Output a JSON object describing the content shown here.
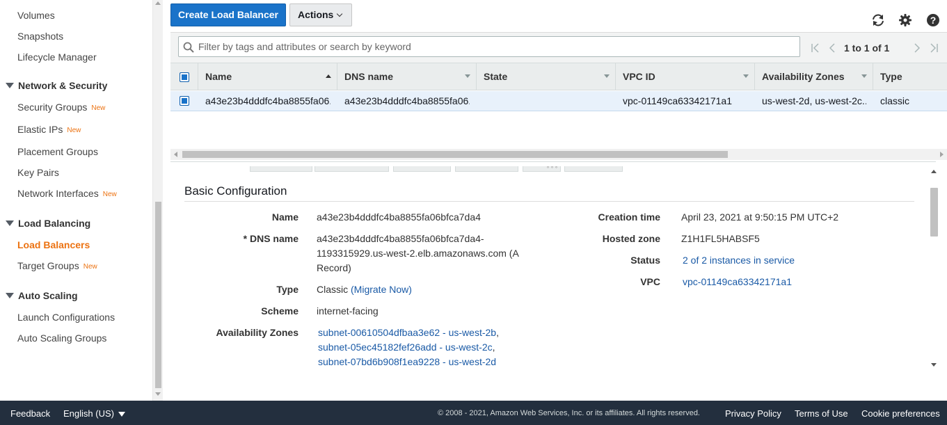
{
  "sidebar": {
    "links_top": [
      {
        "label": "Volumes"
      },
      {
        "label": "Snapshots"
      },
      {
        "label": "Lifecycle Manager"
      }
    ],
    "network_security": {
      "title": "Network & Security",
      "items": [
        {
          "label": "Security Groups",
          "badge": "New"
        },
        {
          "label": "Elastic IPs",
          "badge": "New"
        },
        {
          "label": "Placement Groups"
        },
        {
          "label": "Key Pairs"
        },
        {
          "label": "Network Interfaces",
          "badge": "New"
        }
      ]
    },
    "load_balancing": {
      "title": "Load Balancing",
      "items": [
        {
          "label": "Load Balancers"
        },
        {
          "label": "Target Groups",
          "badge": "New"
        }
      ]
    },
    "auto_scaling": {
      "title": "Auto Scaling",
      "items": [
        {
          "label": "Launch Configurations"
        },
        {
          "label": "Auto Scaling Groups"
        }
      ]
    }
  },
  "toolbar": {
    "create_label": "Create Load Balancer",
    "actions_label": "Actions",
    "icons": [
      "refresh-icon",
      "gear-icon",
      "help-icon"
    ]
  },
  "filter": {
    "placeholder": "Filter by tags and attributes or search by keyword",
    "pager_text": "1 to 1 of 1"
  },
  "table": {
    "columns": [
      "Name",
      "DNS name",
      "State",
      "VPC ID",
      "Availability Zones",
      "Type"
    ],
    "rows": [
      {
        "name": "a43e23b4dddfc4ba8855fa06...",
        "dns": "a43e23b4dddfc4ba8855fa06...",
        "state": "",
        "vpc": "vpc-01149ca63342171a1",
        "zones": "us-west-2d, us-west-2c...",
        "type": "classic"
      }
    ]
  },
  "detail": {
    "title": "Basic Configuration",
    "left": {
      "name_label": "Name",
      "name_value": "a43e23b4dddfc4ba8855fa06bfca7da4",
      "dns_label": "* DNS name",
      "dns_value_lines": [
        "a43e23b4dddfc4ba8855fa06bfca7da4-",
        "1193315929.us-west-2.elb.amazonaws.com (A",
        "Record)"
      ],
      "type_label": "Type",
      "type_value": "Classic",
      "type_link": "(Migrate Now)",
      "scheme_label": "Scheme",
      "scheme_value": "internet-facing",
      "az_label": "Availability Zones",
      "az_values": [
        "subnet-00610504dfbaa3e62 - us-west-2b",
        "subnet-05ec45182fef26add - us-west-2c",
        "subnet-07bd6b908f1ea9228 - us-west-2d"
      ]
    },
    "right": {
      "created_label": "Creation time",
      "created_value": "April 23, 2021 at 9:50:15 PM UTC+2",
      "zone_label": "Hosted zone",
      "zone_value": "Z1H1FL5HABSF5",
      "status_label": "Status",
      "status_value": "2 of 2 instances in service",
      "vpc_label": "VPC",
      "vpc_value": "vpc-01149ca63342171a1"
    }
  },
  "footer": {
    "feedback": "Feedback",
    "language": "English (US)",
    "copyright": "© 2008 - 2021, Amazon Web Services, Inc. or its affiliates. All rights reserved.",
    "privacy": "Privacy Policy",
    "terms": "Terms of Use",
    "cookies": "Cookie preferences"
  },
  "colors": {
    "accent_orange": "#ec7211",
    "primary_blue": "#1a73c9",
    "link_blue": "#1a5aa6",
    "footer_bg": "#232f3e"
  }
}
